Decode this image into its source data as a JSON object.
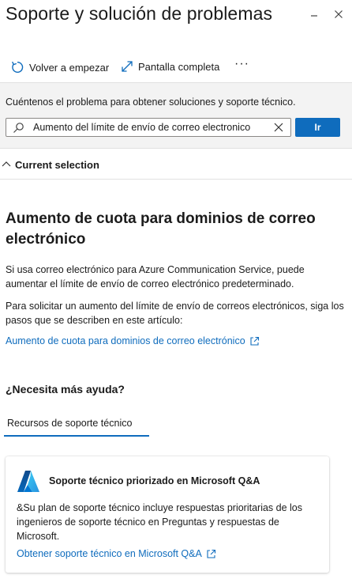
{
  "header": {
    "title": "Soporte y solución de problemas",
    "minimize_icon": "minimize-icon",
    "close_icon": "close-icon"
  },
  "toolbar": {
    "restart_label": "Volver a empezar",
    "restart_icon": "refresh-icon",
    "fullscreen_label": "Pantalla completa",
    "fullscreen_icon": "expand-icon",
    "more_label": "···"
  },
  "search": {
    "prompt": "Cuéntenos el problema para obtener soluciones y soporte técnico.",
    "value": "Aumento del límite de envío de correo electronico",
    "go_label": "Ir"
  },
  "selection": {
    "label": "Current selection"
  },
  "article": {
    "title": "Aumento de cuota para dominios de correo electrónico",
    "paragraph1": "Si usa correo electrónico para Azure Communication Service, puede aumentar el límite de envío de correo electrónico predeterminado.",
    "paragraph2": "Para solicitar un aumento del límite de envío de correos electrónicos, siga los pasos que se describen en este artículo:",
    "link_label": "Aumento de cuota para dominios de correo electrónico"
  },
  "help": {
    "title": "¿Necesita más ayuda?",
    "tab_label": "Recursos de soporte técnico",
    "card": {
      "title": "Soporte técnico priorizado en Microsoft Q&A",
      "body": "&Su plan de soporte técnico incluye respuestas prioritarias de los ingenieros de soporte técnico en Preguntas y respuestas de Microsoft.",
      "link_label": "Obtener soporte técnico en Microsoft Q&A"
    }
  },
  "colors": {
    "accent": "#0f6cbd",
    "search_bg": "#f3f3f3",
    "text": "#1b1b1b"
  }
}
